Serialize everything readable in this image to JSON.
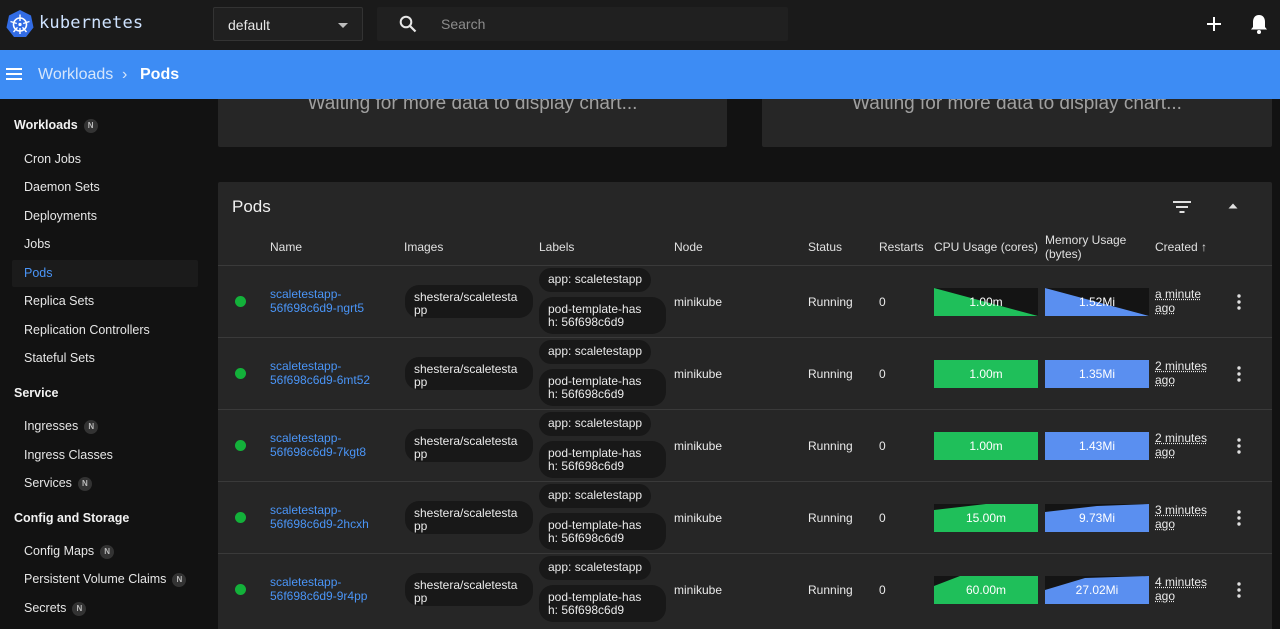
{
  "app": {
    "brand": "kubernetes"
  },
  "namespace": {
    "value": "default"
  },
  "search": {
    "placeholder": "Search"
  },
  "breadcrumb": {
    "parent": "Workloads",
    "separator": "›",
    "current": "Pods"
  },
  "sidebar": {
    "groups": [
      {
        "title": "Workloads",
        "badge": "N",
        "items": [
          {
            "label": "Cron Jobs"
          },
          {
            "label": "Daemon Sets"
          },
          {
            "label": "Deployments"
          },
          {
            "label": "Jobs"
          },
          {
            "label": "Pods",
            "active": true
          },
          {
            "label": "Replica Sets"
          },
          {
            "label": "Replication Controllers"
          },
          {
            "label": "Stateful Sets"
          }
        ]
      },
      {
        "title": "Service",
        "items": [
          {
            "label": "Ingresses",
            "badge": "N"
          },
          {
            "label": "Ingress Classes"
          },
          {
            "label": "Services",
            "badge": "N"
          }
        ]
      },
      {
        "title": "Config and Storage",
        "items": [
          {
            "label": "Config Maps",
            "badge": "N"
          },
          {
            "label": "Persistent Volume Claims",
            "badge": "N"
          },
          {
            "label": "Secrets",
            "badge": "N"
          }
        ]
      }
    ]
  },
  "charts": {
    "cpu_waiting": "Waiting for more data to display chart...",
    "memory_waiting": "Waiting for more data to display chart..."
  },
  "pods": {
    "title": "Pods",
    "columns": {
      "name": "Name",
      "images": "Images",
      "labels": "Labels",
      "node": "Node",
      "status": "Status",
      "restarts": "Restarts",
      "cpu": "CPU Usage (cores)",
      "memory_line1": "Memory Usage",
      "memory_line2": "(bytes)",
      "created": "Created ↑"
    },
    "rows": [
      {
        "name1": "scaletestapp-",
        "name2": "56f698c6d9-ngrt5",
        "image1": "shestera/scaletesta",
        "image2": "pp",
        "label1": "app: scaletestapp",
        "label2a": "pod-template-has",
        "label2b": "h: 56f698c6d9",
        "node": "minikube",
        "status": "Running",
        "restarts": "0",
        "cpu": "1.00m",
        "memory": "1.52Mi",
        "created1": "a minute",
        "created2": "ago"
      },
      {
        "name1": "scaletestapp-",
        "name2": "56f698c6d9-6mt52",
        "image1": "shestera/scaletesta",
        "image2": "pp",
        "label1": "app: scaletestapp",
        "label2a": "pod-template-has",
        "label2b": "h: 56f698c6d9",
        "node": "minikube",
        "status": "Running",
        "restarts": "0",
        "cpu": "1.00m",
        "memory": "1.35Mi",
        "created1": "2 minutes",
        "created2": "ago"
      },
      {
        "name1": "scaletestapp-",
        "name2": "56f698c6d9-7kgt8",
        "image1": "shestera/scaletesta",
        "image2": "pp",
        "label1": "app: scaletestapp",
        "label2a": "pod-template-has",
        "label2b": "h: 56f698c6d9",
        "node": "minikube",
        "status": "Running",
        "restarts": "0",
        "cpu": "1.00m",
        "memory": "1.43Mi",
        "created1": "2 minutes",
        "created2": "ago"
      },
      {
        "name1": "scaletestapp-",
        "name2": "56f698c6d9-2hcxh",
        "image1": "shestera/scaletesta",
        "image2": "pp",
        "label1": "app: scaletestapp",
        "label2a": "pod-template-has",
        "label2b": "h: 56f698c6d9",
        "node": "minikube",
        "status": "Running",
        "restarts": "0",
        "cpu": "15.00m",
        "memory": "9.73Mi",
        "created1": "3 minutes",
        "created2": "ago"
      },
      {
        "name1": "scaletestapp-",
        "name2": "56f698c6d9-9r4pp",
        "image1": "shestera/scaletesta",
        "image2": "pp",
        "label1": "app: scaletestapp",
        "label2a": "pod-template-has",
        "label2b": "h: 56f698c6d9",
        "node": "minikube",
        "status": "Running",
        "restarts": "0",
        "cpu": "60.00m",
        "memory": "27.02Mi",
        "created1": "4 minutes",
        "created2": "ago"
      }
    ]
  },
  "colors": {
    "accent": "#3d8cf4",
    "link": "#4a95f7",
    "running": "#13b13a",
    "cpu_fill": "#1fbf5a",
    "memory_fill": "#5a8ff0"
  }
}
